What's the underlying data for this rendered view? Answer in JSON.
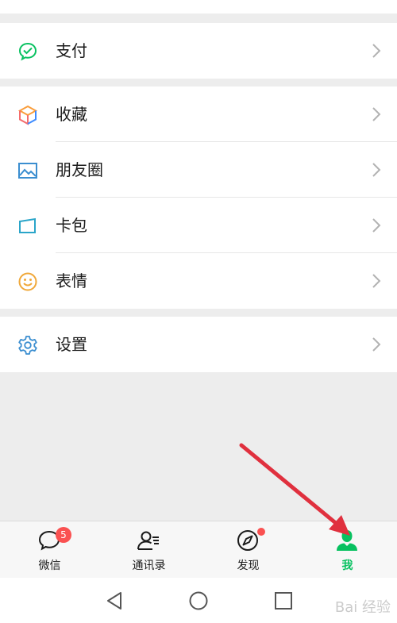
{
  "menu": {
    "pay": "支付",
    "favorites": "收藏",
    "moments": "朋友圈",
    "cards": "卡包",
    "stickers": "表情",
    "settings": "设置"
  },
  "tabbar": {
    "chats": {
      "label": "微信",
      "badge": "5"
    },
    "contacts": {
      "label": "通讯录"
    },
    "discover": {
      "label": "发现"
    },
    "me": {
      "label": "我"
    }
  },
  "colors": {
    "accent": "#07c160",
    "badge": "#fa5151",
    "arrow": "#e0303e",
    "background": "#ededed"
  },
  "watermark": "Bai 经验"
}
